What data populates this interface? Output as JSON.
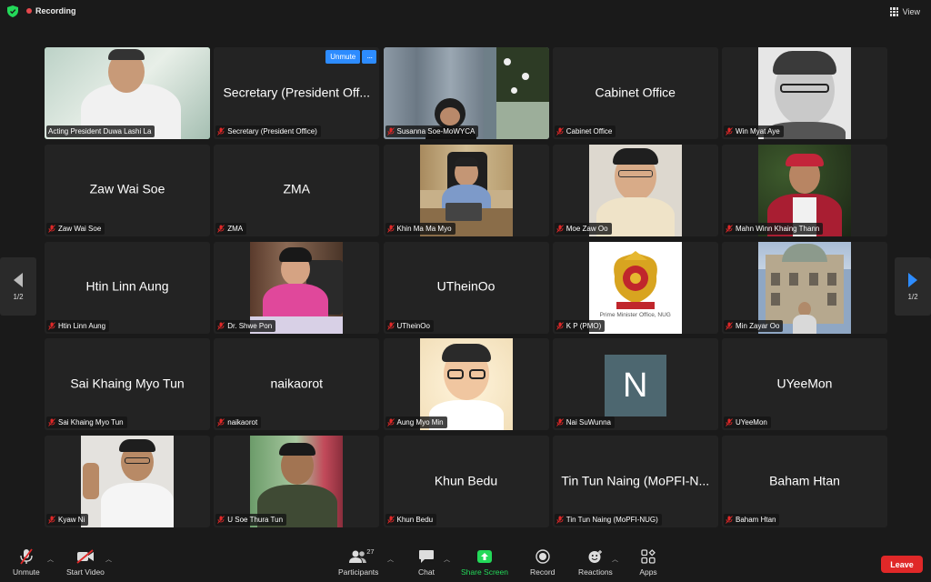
{
  "topbar": {
    "recording_label": "Recording",
    "view_label": "View"
  },
  "pagination": {
    "left_label": "1/2",
    "right_label": "1/2"
  },
  "tiles": [
    {
      "big": "",
      "name": "Acting President Duwa Lashi La"
    },
    {
      "big": "Secretary (President Off...",
      "name": "Secretary (President Office)",
      "unmute": "Unmute",
      "more": "···"
    },
    {
      "big": "",
      "name": "Susanna Soe-MoWYCA"
    },
    {
      "big": "Cabinet Office",
      "name": "Cabinet Office"
    },
    {
      "big": "",
      "name": "Win Myat Aye"
    },
    {
      "big": "Zaw Wai Soe",
      "name": "Zaw Wai Soe"
    },
    {
      "big": "ZMA",
      "name": "ZMA"
    },
    {
      "big": "",
      "name": "Khin Ma Ma Myo"
    },
    {
      "big": "",
      "name": "Moe Zaw Oo"
    },
    {
      "big": "",
      "name": "Mahn Winn Khaing Thann"
    },
    {
      "big": "Htin Linn Aung",
      "name": "Htin Linn Aung"
    },
    {
      "big": "",
      "name": "Dr. Shwe Pon"
    },
    {
      "big": "UTheinOo",
      "name": "UTheinOo"
    },
    {
      "big": "",
      "name": "K P (PMO)",
      "caption": "Prime Minister Office, NUG"
    },
    {
      "big": "",
      "name": "Min Zayar Oo"
    },
    {
      "big": "Sai Khaing Myo Tun",
      "name": "Sai Khaing Myo Tun"
    },
    {
      "big": "naikaorot",
      "name": "naikaorot"
    },
    {
      "big": "",
      "name": "Aung Myo Min"
    },
    {
      "big": "",
      "name": "Nai SuWunna",
      "avatar_letter": "N"
    },
    {
      "big": "UYeeMon",
      "name": "UYeeMon"
    },
    {
      "big": "",
      "name": "Kyaw Ni"
    },
    {
      "big": "",
      "name": "U Soe Thura Tun"
    },
    {
      "big": "Khun Bedu",
      "name": "Khun Bedu"
    },
    {
      "big": "Tin Tun Naing (MoPFI-N...",
      "name": "Tin Tun Naing (MoPFI-NUG)"
    },
    {
      "big": "Baham Htan",
      "name": "Baham Htan"
    }
  ],
  "toolbar": {
    "unmute": "Unmute",
    "start_video": "Start Video",
    "participants": "Participants",
    "participants_count": "27",
    "chat": "Chat",
    "share_screen": "Share Screen",
    "record": "Record",
    "reactions": "Reactions",
    "apps": "Apps",
    "leave": "Leave"
  },
  "colors": {
    "accent": "#2d8cff",
    "active_speaker": "#23d959",
    "leave": "#e02828",
    "recording": "#e5484d"
  }
}
